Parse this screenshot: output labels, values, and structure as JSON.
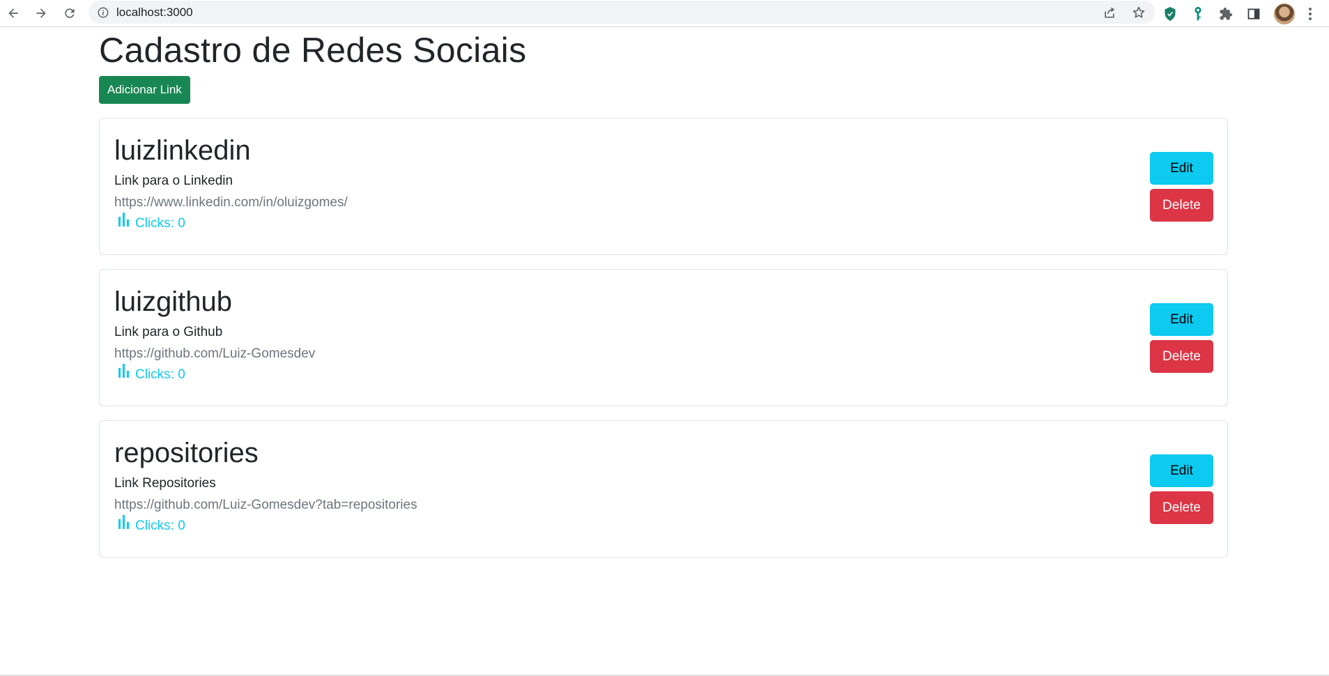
{
  "browser": {
    "url": "localhost:3000",
    "colors": {
      "shield": "#1a7f64",
      "key": "#0a8a7a"
    }
  },
  "page": {
    "title": "Cadastro de Redes Sociais",
    "add_button_label": "Adicionar Link",
    "colors": {
      "success": "#198754",
      "info": "#0dcaf0",
      "danger": "#dc3545",
      "muted": "#6c757d"
    }
  },
  "links": [
    {
      "name": "luizlinkedin",
      "description": "Link para o Linkedin",
      "url": "https://www.linkedin.com/in/oluizgomes/",
      "clicks": "Clicks: 0",
      "edit_label": "Edit",
      "delete_label": "Delete"
    },
    {
      "name": "luizgithub",
      "description": "Link para o Github",
      "url": "https://github.com/Luiz-Gomesdev",
      "clicks": "Clicks: 0",
      "edit_label": "Edit",
      "delete_label": "Delete"
    },
    {
      "name": "repositories",
      "description": "Link Repositories",
      "url": "https://github.com/Luiz-Gomesdev?tab=repositories",
      "clicks": "Clicks: 0",
      "edit_label": "Edit",
      "delete_label": "Delete"
    }
  ],
  "icons": {
    "back": "arrow-left-icon",
    "forward": "arrow-right-icon",
    "reload": "reload-icon",
    "site_info": "info-icon",
    "share": "share-icon",
    "bookmark": "star-icon",
    "extension_shield": "shield-icon",
    "extension_key": "key-icon",
    "extensions": "puzzle-icon",
    "side_panel": "side-panel-icon",
    "clicks": "bar-chart-icon"
  }
}
